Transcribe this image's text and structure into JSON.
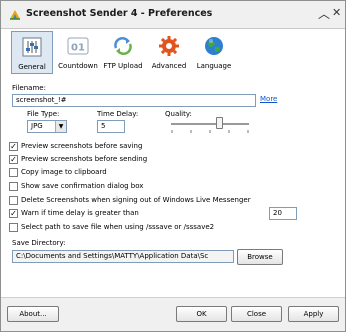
{
  "window": {
    "title": "Screenshot Sender 4 - Preferences",
    "controls": {
      "collapse": "︿",
      "close": "✕"
    }
  },
  "tabs": [
    {
      "label": "General",
      "icon": "general-sliders-icon",
      "active": true
    },
    {
      "label": "Countdown",
      "icon": "countdown-01-icon",
      "active": false
    },
    {
      "label": "FTP Upload",
      "icon": "ftp-upload-arrows-icon",
      "active": false
    },
    {
      "label": "Advanced",
      "icon": "gear-icon",
      "active": false
    },
    {
      "label": "Language",
      "icon": "globe-icon",
      "active": false
    }
  ],
  "general": {
    "filename_label": "Filename:",
    "filename_value": "screenshot_!#",
    "more_link": "More",
    "filetype_label": "File Type:",
    "filetype_value": "JPG",
    "timedelay_label": "Time Delay:",
    "timedelay_value": "5",
    "quality_label": "Quality:",
    "quality_level": 0.62,
    "options": [
      {
        "label": "Preview screenshots before saving",
        "checked": true
      },
      {
        "label": "Preview screenshots before sending",
        "checked": true
      },
      {
        "label": "Copy image to clipboard",
        "checked": false
      },
      {
        "label": "Show save confirmation dialog box",
        "checked": false
      },
      {
        "label": "Delete Screenshots when signing out of Windows Live Messenger",
        "checked": false
      },
      {
        "label": "Warn if time delay is greater than",
        "checked": true
      },
      {
        "label": "Select path to save file when using /sssave or /sssave2",
        "checked": false
      }
    ],
    "warn_delay_value": "20",
    "save_dir_label": "Save Directory:",
    "save_dir_value": "C:\\Documents and Settings\\MATTY\\Application Data\\Sc",
    "browse_button": "Browse"
  },
  "footer": {
    "about_button": "About...",
    "ok_button": "OK",
    "close_button": "Close",
    "apply_button": "Apply"
  },
  "colors": {
    "accent_blue": "#1155cc",
    "tab_active_bg": "#dde8f3",
    "field_border": "#7f9db9"
  }
}
